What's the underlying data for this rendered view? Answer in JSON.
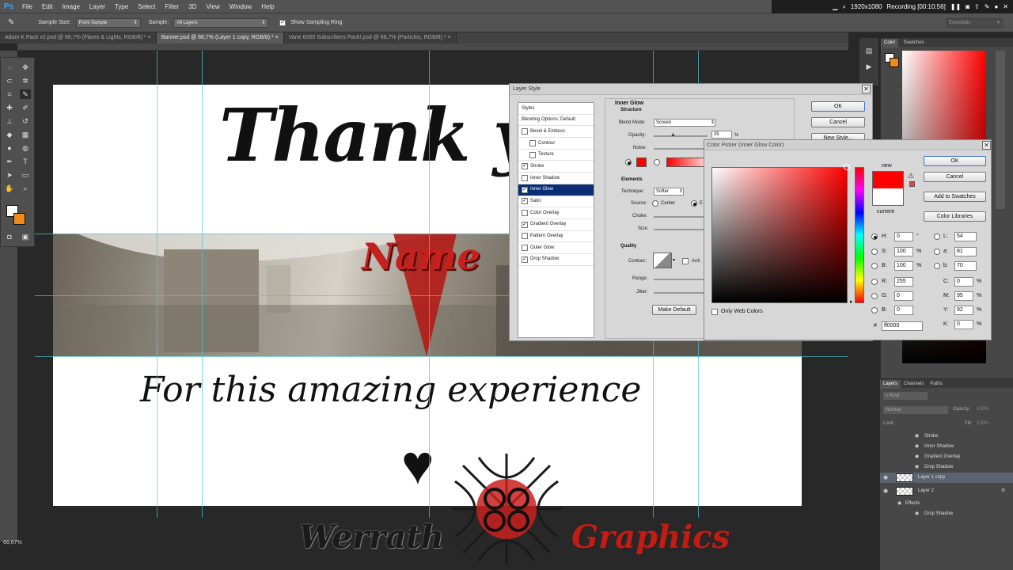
{
  "app": {
    "logo": "Ps"
  },
  "menu": [
    "File",
    "Edit",
    "Image",
    "Layer",
    "Type",
    "Select",
    "Filter",
    "3D",
    "View",
    "Window",
    "Help"
  ],
  "recording": {
    "resolution": "1920x1080",
    "status": "Recording [00:10:56]"
  },
  "options": {
    "sample_size_label": "Sample Size:",
    "sample_size_value": "Point Sample",
    "sample_label": "Sample:",
    "sample_value": "All Layers",
    "sampling_ring_label": "Show Sampling Ring",
    "workspace": "Essentials"
  },
  "tabs": [
    {
      "label": "Adam K Pack v2.psd @ 66,7% (Flares & Lights, RGB/8) *"
    },
    {
      "label": "Banner.psd @ 66,7% (Layer 1 copy, RGB/8) *"
    },
    {
      "label": "Vane 6000 Subscribers Pack!.psd @ 66,7% (Particles, RGB/8) *"
    }
  ],
  "canvas": {
    "thank_text": "Thank y",
    "name_text": "Name",
    "sub_text": "For this amazing experience",
    "heart": "♥"
  },
  "watermark": {
    "left": "Werrath",
    "right": "Graphics"
  },
  "zoom": "66,67%",
  "layer_style": {
    "title": "Layer Style",
    "list": [
      {
        "label": "Styles",
        "check": null,
        "sel": false,
        "indent": false
      },
      {
        "label": "Blending Options: Default",
        "check": null,
        "sel": false,
        "indent": false
      },
      {
        "label": "Bevel & Emboss",
        "check": false,
        "sel": false,
        "indent": false
      },
      {
        "label": "Contour",
        "check": false,
        "sel": false,
        "indent": true
      },
      {
        "label": "Texture",
        "check": false,
        "sel": false,
        "indent": true
      },
      {
        "label": "Stroke",
        "check": true,
        "sel": false,
        "indent": false
      },
      {
        "label": "Inner Shadow",
        "check": false,
        "sel": false,
        "indent": false
      },
      {
        "label": "Inner Glow",
        "check": true,
        "sel": true,
        "indent": false
      },
      {
        "label": "Satin",
        "check": true,
        "sel": false,
        "indent": false
      },
      {
        "label": "Color Overlay",
        "check": false,
        "sel": false,
        "indent": false
      },
      {
        "label": "Gradient Overlay",
        "check": true,
        "sel": false,
        "indent": false
      },
      {
        "label": "Pattern Overlay",
        "check": false,
        "sel": false,
        "indent": false
      },
      {
        "label": "Outer Glow",
        "check": false,
        "sel": false,
        "indent": false
      },
      {
        "label": "Drop Shadow",
        "check": true,
        "sel": false,
        "indent": false
      }
    ],
    "section": "Inner Glow",
    "structure": "Structure",
    "blend_mode_label": "Blend Mode:",
    "blend_mode_value": "Screen",
    "opacity_label": "Opacity:",
    "opacity_value": "35",
    "opacity_unit": "%",
    "noise_label": "Noise:",
    "elements": "Elements",
    "technique_label": "Technique:",
    "technique_value": "Softer",
    "source_label": "Source:",
    "source_center": "Center",
    "source_edge": "E",
    "choke_label": "Choke:",
    "size_label": "Size:",
    "quality": "Quality",
    "contour_label": "Contour:",
    "antialias": "Anti",
    "range_label": "Range:",
    "jitter_label": "Jitter:",
    "make_default": "Make Default",
    "ok": "OK",
    "cancel": "Cancel",
    "new_style": "New Style..."
  },
  "color_picker": {
    "title": "Color Picker (Inner Glow Color)",
    "new_label": "new",
    "current_label": "current",
    "ok": "OK",
    "cancel": "Cancel",
    "add_swatches": "Add to Swatches",
    "libraries": "Color Libraries",
    "only_web": "Only Web Colors",
    "H": "0",
    "H_unit": "°",
    "S": "100",
    "S_unit": "%",
    "B": "100",
    "B_unit": "%",
    "R": "255",
    "G": "0",
    "Bl": "0",
    "L": "54",
    "a": "81",
    "b": "70",
    "C": "0",
    "M": "95",
    "Y": "92",
    "K": "0",
    "pct": "%",
    "hex_label": "#",
    "hex": "ff0000",
    "new_color": "#ff0000",
    "current_color": "#ffffff"
  },
  "color_panel": {
    "tab_color": "Color",
    "tab_swatches": "Swatches"
  },
  "layers_panel": {
    "tabs": [
      "Layers",
      "Channels",
      "Paths"
    ],
    "kind": "Kind",
    "blend": "Normal",
    "opacity_label": "Opacity:",
    "opacity": "100%",
    "lock_label": "Lock:",
    "fill_label": "Fill:",
    "fill": "100%",
    "rows": [
      {
        "label": "Stroke",
        "type": "effect"
      },
      {
        "label": "Inner Shadow",
        "type": "effect"
      },
      {
        "label": "Gradient Overlay",
        "type": "effect"
      },
      {
        "label": "Drop Shadow",
        "type": "effect"
      },
      {
        "label": "Layer 1 copy",
        "type": "layer",
        "selected": true
      },
      {
        "label": "Layer 2",
        "type": "layer",
        "fx": "fx"
      },
      {
        "label": "Effects",
        "type": "effects"
      },
      {
        "label": "Drop Shadow",
        "type": "effect"
      }
    ]
  }
}
